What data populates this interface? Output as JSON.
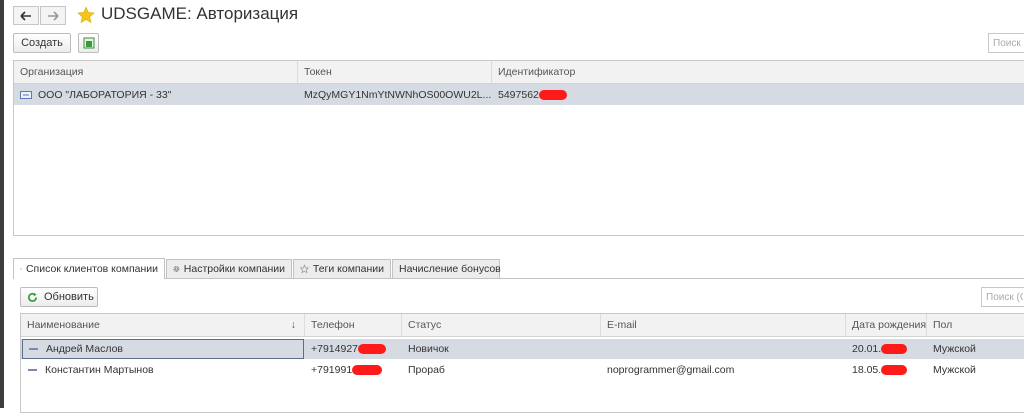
{
  "title": "UDSGAME:  Авторизация",
  "toolbar": {
    "create_label": "Создать",
    "search_placeholder": "Поиск (Ctrl+F)"
  },
  "auth_table": {
    "columns": [
      "Организация",
      "Токен",
      "Идентификатор"
    ],
    "rows": [
      {
        "org": "ООО \"ЛАБОРАТОРИЯ - 33\"",
        "token": "MzQyMGY1NmYtNWNhOS00OWU2L...",
        "id": "5497562"
      }
    ]
  },
  "tabs": [
    "Список клиентов компании",
    "Настройки компании",
    "Теги компании",
    "Начисление бонусов"
  ],
  "clients": {
    "refresh_label": "Обновить",
    "search_placeholder": "Поиск (Ctrl+F)",
    "columns": [
      "Наименование",
      "Телефон",
      "Статус",
      "E-mail",
      "Дата рождения",
      "Пол"
    ],
    "sort_indicator": "↓",
    "rows": [
      {
        "name": "Андрей Маслов",
        "phone": "+7914927",
        "status": "Новичок",
        "email": "",
        "birth": "20.01.",
        "gender": "Мужской"
      },
      {
        "name": "Константин Мартынов",
        "phone": "+791991",
        "status": "Прораб",
        "email": "noprogrammer@gmail.com",
        "birth": "18.05.",
        "gender": "Мужской"
      }
    ]
  },
  "colors": {
    "accent_star": "#f5c518",
    "selection": "#d6dbe3",
    "redaction": "#ff1a1a",
    "refresh_green": "#2e9e3e"
  }
}
